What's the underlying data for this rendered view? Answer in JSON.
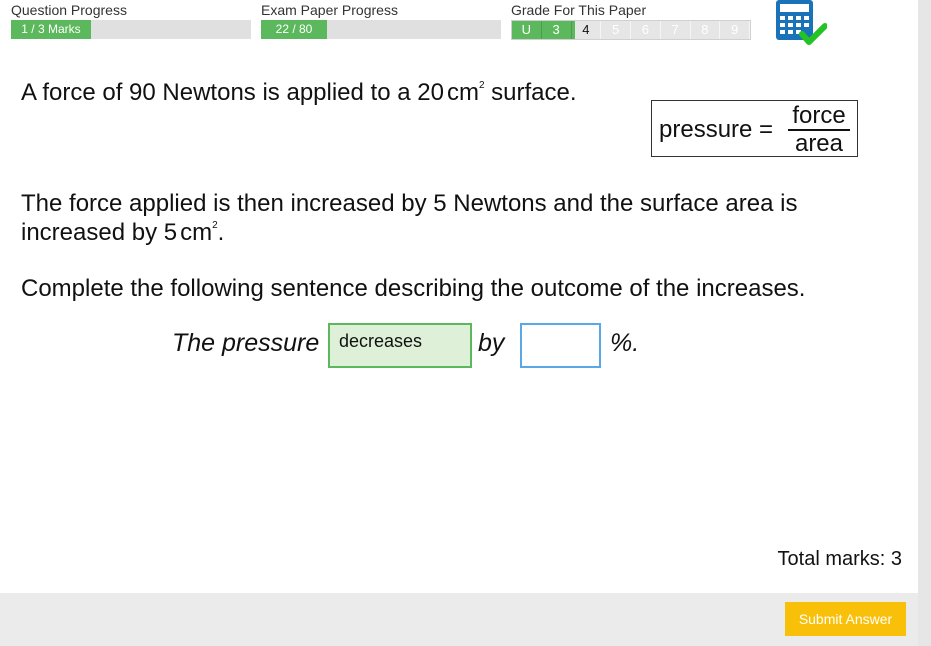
{
  "progress": {
    "question": {
      "label": "Question Progress",
      "value_text": "1 / 3 Marks",
      "fraction": 0.333
    },
    "exam": {
      "label": "Exam Paper Progress",
      "value_text": "22 / 80",
      "fraction": 0.275
    },
    "grade": {
      "label": "Grade For This Paper",
      "cells": [
        "U",
        "3",
        "4",
        "5",
        "6",
        "7",
        "8",
        "9"
      ],
      "achieved_count": 2,
      "current": "4"
    }
  },
  "calculator": {
    "icon": "calculator-allowed-icon",
    "colors": {
      "calc": "#1a73b8",
      "check": "#22c322"
    }
  },
  "question": {
    "line1": {
      "pre": "A force of 90 Newtons is applied to a 20",
      "unit": "cm",
      "exp": "2",
      "post": "surface."
    },
    "formula": {
      "lhs": "pressure =",
      "numerator": "force",
      "denominator": "area"
    },
    "line2a": "The force applied is then increased by 5 Newtons and the surface area is",
    "line2b": {
      "pre": "increased by 5",
      "unit": "cm",
      "exp": "2",
      "post": "."
    },
    "line3": "Complete the following sentence describing the outcome of the increases."
  },
  "answer": {
    "prefix": "The pressure",
    "choice": "decreases",
    "middle": "by",
    "input_value": "",
    "suffix": "%."
  },
  "total_marks": "Total marks: 3",
  "submit_label": "Submit Answer",
  "colors": {
    "progress": "#5cb85c",
    "submit": "#f9c00a",
    "input_border": "#5aa9e6"
  }
}
